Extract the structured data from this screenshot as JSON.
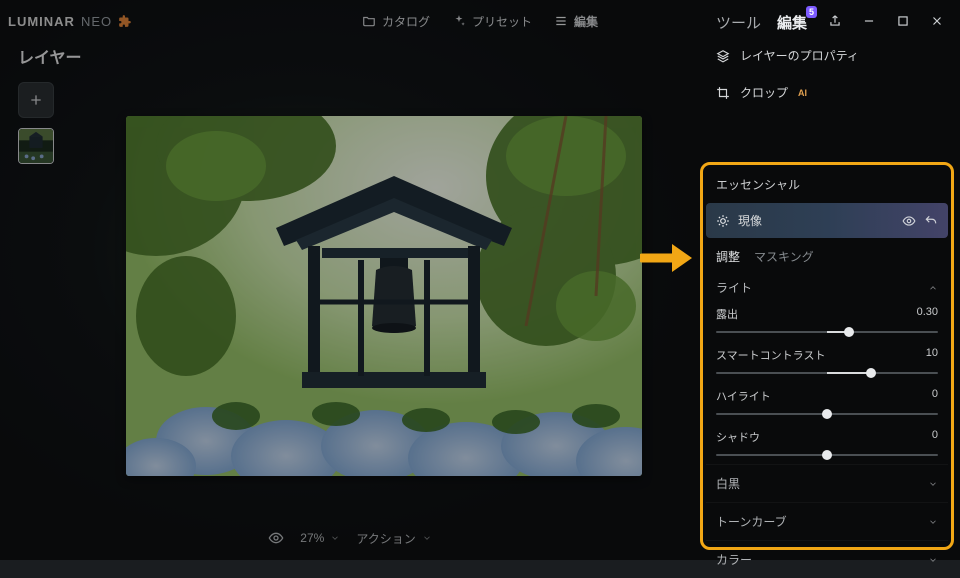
{
  "app": {
    "name": "LUMINAR",
    "sub": "NEO"
  },
  "topnav": {
    "catalog": "カタログ",
    "presets": "プリセット",
    "edit": "編集"
  },
  "layers": {
    "title": "レイヤー"
  },
  "rightTabs": {
    "tools": "ツール",
    "edits": "編集",
    "badge": "5"
  },
  "panelRows": {
    "layerProps": "レイヤーのプロパティ",
    "crop": "クロップ",
    "ai": "AI"
  },
  "essentials": {
    "header": "エッセンシャル",
    "develop": "現像",
    "subtabs": {
      "adjust": "調整",
      "masking": "マスキング"
    },
    "group": "ライト",
    "sliders": [
      {
        "label": "露出",
        "value": "0.30",
        "pos": 0.6,
        "fillFrom": 0.5,
        "fillTo": 0.6
      },
      {
        "label": "スマートコントラスト",
        "value": "10",
        "pos": 0.7,
        "fillFrom": 0.5,
        "fillTo": 0.7
      },
      {
        "label": "ハイライト",
        "value": "0",
        "pos": 0.5,
        "fillFrom": 0.5,
        "fillTo": 0.5
      },
      {
        "label": "シャドウ",
        "value": "0",
        "pos": 0.5,
        "fillFrom": 0.5,
        "fillTo": 0.5
      }
    ],
    "closed": [
      "白黒",
      "トーンカーブ",
      "カラー"
    ]
  },
  "bottom": {
    "zoom": "27%",
    "action": "アクション"
  }
}
